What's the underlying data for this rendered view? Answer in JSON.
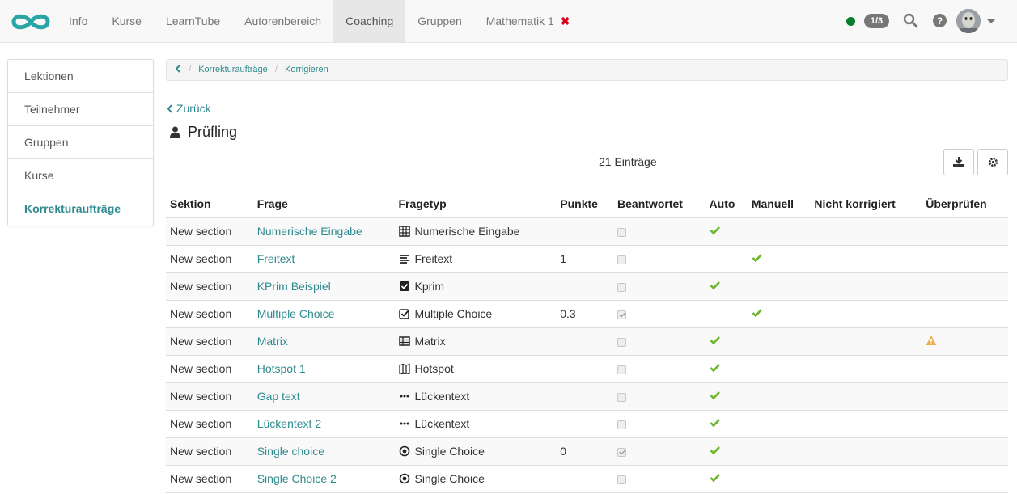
{
  "nav": {
    "items": [
      "Info",
      "Kurse",
      "LearnTube",
      "Autorenbereich",
      "Coaching",
      "Gruppen",
      "Mathematik 1"
    ],
    "active": "Coaching",
    "close_glyph": "✖"
  },
  "status": {
    "badge": "1/3",
    "dot_color": "#0a7d2c"
  },
  "icons": {
    "search": "search-icon",
    "help": "help-icon",
    "user": "user-avatar"
  },
  "sidebar": {
    "items": [
      {
        "label": "Lektionen"
      },
      {
        "label": "Teilnehmer"
      },
      {
        "label": "Gruppen"
      },
      {
        "label": "Kurse"
      },
      {
        "label": "Korrekturaufträge",
        "active": true
      }
    ]
  },
  "breadcrumb": {
    "items": [
      "Korrekturaufträge",
      "Korrigieren"
    ]
  },
  "back_label": "Zurück",
  "title": "Prüfling",
  "entries_count": "21 Einträge",
  "table": {
    "headers": [
      "Sektion",
      "Frage",
      "Fragetyp",
      "Punkte",
      "Beantwortet",
      "Auto",
      "Manuell",
      "Nicht korrigiert",
      "Überprüfen"
    ],
    "rows": [
      {
        "section": "New section",
        "question": "Numerische Eingabe",
        "type": "Numerische Eingabe",
        "type_icon": "calculator-icon",
        "points": "",
        "answered": false,
        "auto": true,
        "manual": false,
        "warning": false
      },
      {
        "section": "New section",
        "question": "Freitext",
        "type": "Freitext",
        "type_icon": "align-left-icon",
        "points": "1",
        "answered": false,
        "auto": false,
        "manual": true,
        "warning": false
      },
      {
        "section": "New section",
        "question": "KPrim Beispiel",
        "type": "Kprim",
        "type_icon": "check-square-icon",
        "points": "",
        "answered": false,
        "auto": true,
        "manual": false,
        "warning": false
      },
      {
        "section": "New section",
        "question": "Multiple Choice",
        "type": "Multiple Choice",
        "type_icon": "check-square-outline-icon",
        "points": "0.3",
        "answered": true,
        "auto": false,
        "manual": true,
        "warning": false
      },
      {
        "section": "New section",
        "question": "Matrix",
        "type": "Matrix",
        "type_icon": "table-icon",
        "points": "",
        "answered": false,
        "auto": true,
        "manual": false,
        "warning": true
      },
      {
        "section": "New section",
        "question": "Hotspot 1",
        "type": "Hotspot",
        "type_icon": "map-icon",
        "points": "",
        "answered": false,
        "auto": true,
        "manual": false,
        "warning": false
      },
      {
        "section": "New section",
        "question": "Gap text",
        "type": "Lückentext",
        "type_icon": "ellipsis-icon",
        "points": "",
        "answered": false,
        "auto": true,
        "manual": false,
        "warning": false
      },
      {
        "section": "New section",
        "question": "Lückentext 2",
        "type": "Lückentext",
        "type_icon": "ellipsis-icon",
        "points": "",
        "answered": false,
        "auto": true,
        "manual": false,
        "warning": false
      },
      {
        "section": "New section",
        "question": "Single choice",
        "type": "Single Choice",
        "type_icon": "dot-circle-icon",
        "points": "0",
        "answered": true,
        "auto": true,
        "manual": false,
        "warning": false
      },
      {
        "section": "New section",
        "question": "Single Choice 2",
        "type": "Single Choice",
        "type_icon": "dot-circle-icon",
        "points": "",
        "answered": false,
        "auto": true,
        "manual": false,
        "warning": false
      }
    ]
  },
  "colors": {
    "accent": "#2f8a8f",
    "check": "#6bb52d",
    "warning": "#f0ad4e",
    "close": "#d9001b"
  }
}
